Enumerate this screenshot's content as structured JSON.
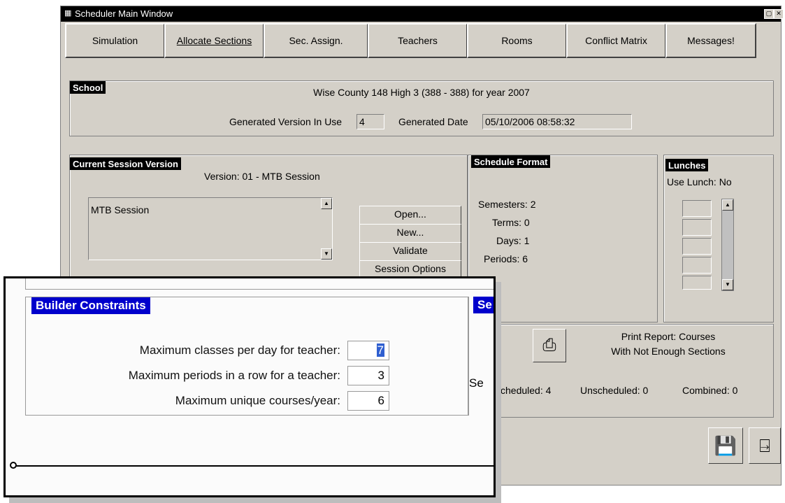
{
  "window": {
    "title": "Scheduler Main Window",
    "icons": [
      "app-icon",
      "restore-icon",
      "close-icon"
    ]
  },
  "tabs": [
    {
      "label": "Simulation"
    },
    {
      "label": "Allocate Sections"
    },
    {
      "label": "Sec. Assign."
    },
    {
      "label": "Teachers"
    },
    {
      "label": "Rooms"
    },
    {
      "label": "Conflict Matrix"
    },
    {
      "label": "Messages!"
    }
  ],
  "school": {
    "header": "School",
    "description": "Wise County 148 High 3 (388 - 388) for year 2007",
    "generated_version_label": "Generated Version In Use",
    "generated_version_value": "4",
    "generated_date_label": "Generated Date",
    "generated_date_value": "05/10/2006 08:58:32"
  },
  "session": {
    "header": "Current Session Version",
    "version_text": "Version: 01 - MTB Session",
    "list_item": "MTB Session",
    "buttons": {
      "open": "Open...",
      "new": "New...",
      "validate": "Validate",
      "options": "Session Options"
    }
  },
  "schedule_format": {
    "header": "Schedule Format",
    "semesters": "Semesters: 2",
    "terms": "Terms: 0",
    "days": "Days: 1",
    "periods": "Periods: 6"
  },
  "lunches": {
    "header": "Lunches",
    "use_lunch": "Use Lunch:  No"
  },
  "report": {
    "line1": "Print Report: Courses",
    "line2": "With Not Enough Sections",
    "scheduled": "cheduled: 4",
    "unscheduled": "Unscheduled: 0",
    "combined": "Combined: 0",
    "partial_label": "Se"
  },
  "zoom": {
    "header": "Builder Constraints",
    "partial_header": "Se",
    "rows": [
      {
        "label": "Maximum classes per day for teacher:",
        "value": "7"
      },
      {
        "label": "Maximum periods in a row for a teacher:",
        "value": "3"
      },
      {
        "label": "Maximum unique courses/year:",
        "value": "6"
      }
    ]
  }
}
